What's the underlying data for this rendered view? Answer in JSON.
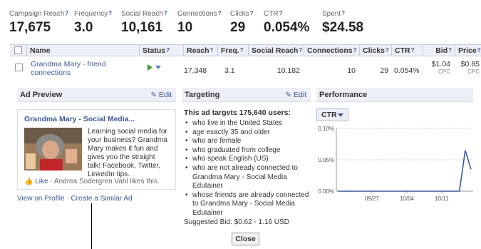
{
  "stats": [
    {
      "label": "Campaign Reach",
      "value": "17,675"
    },
    {
      "label": "Frequency",
      "value": "3.0"
    },
    {
      "label": "Social Reach",
      "value": "10,161"
    },
    {
      "label": "Connections",
      "value": "10"
    },
    {
      "label": "Clicks",
      "value": "29"
    },
    {
      "label": "CTR",
      "value": "0.054%"
    },
    {
      "label": "Spent",
      "value": "$24.58"
    }
  ],
  "table": {
    "headers": [
      "Name",
      "Status",
      "Reach",
      "Freq.",
      "Social Reach",
      "Connections",
      "Clicks",
      "CTR",
      "Bid",
      "Price"
    ],
    "row": {
      "name_line1": "Grandma Mary - friend",
      "name_line2": "connections",
      "reach": "17,348",
      "freq": "3.1",
      "social_reach": "10,182",
      "connections": "10",
      "clicks": "29",
      "ctr": "0.054%",
      "bid": "$1.04",
      "bid_unit": "CPC",
      "price": "$0.85",
      "price_unit": "CPC"
    }
  },
  "ad_preview": {
    "title": "Ad Preview",
    "edit": "Edit",
    "ad_title": "Grandma Mary - Social Media...",
    "ad_body": [
      "Learning social media for",
      "your business? Grandma",
      "Mary makes it fun and",
      "gives you the straight",
      "talk! Facebook, Twitter,",
      "LinkedIn tips."
    ],
    "like": "Like",
    "like_text": "· Andrea Sodergren Vahl likes this.",
    "view_profile": "View on Profile",
    "separator": "·",
    "similar": "Create a Similar Ad"
  },
  "targeting": {
    "title": "Targeting",
    "edit": "Edit",
    "headline": "This ad targets 175,640 users:",
    "items": [
      [
        "who live in the United States"
      ],
      [
        "age exactly 35 and older"
      ],
      [
        "who are female"
      ],
      [
        "who graduated from college"
      ],
      [
        "who speak English (US)"
      ],
      [
        "who are not already connected to",
        "Grandma Mary - Social Media",
        "Edutainer"
      ],
      [
        "whose friends are already connected",
        "to Grandma Mary - Social Media",
        "Edutainer"
      ]
    ],
    "suggested": "Suggested Bid: $0.62 - 1.16 USD",
    "close": "Close"
  },
  "performance": {
    "title": "Performance",
    "metric": "CTR",
    "colors": {
      "line": "#3b5998"
    }
  },
  "chart_data": {
    "type": "line",
    "title": "",
    "xlabel": "",
    "ylabel": "",
    "yticks": [
      "0.10%",
      "0.05%",
      "0.00%"
    ],
    "xticks": [
      "09/27",
      "10/04",
      "10/11"
    ],
    "ylim": [
      0,
      0.1
    ],
    "series": [
      {
        "values": [
          0,
          0,
          0,
          0,
          0,
          0,
          0,
          0,
          0,
          0,
          0,
          0,
          0,
          0,
          0,
          0,
          0,
          0,
          0,
          0,
          0,
          0,
          0.065,
          0.035
        ]
      }
    ]
  }
}
